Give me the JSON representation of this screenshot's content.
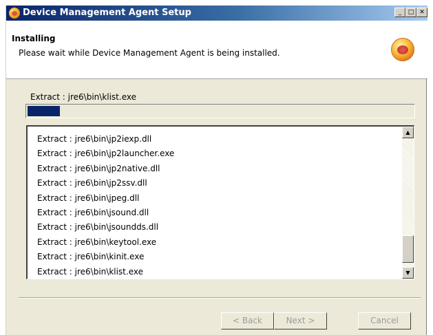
{
  "window": {
    "title": "Device Management Agent Setup",
    "minimize_glyph": "_",
    "maximize_glyph": "□",
    "close_glyph": "✕"
  },
  "header": {
    "title": "Installing",
    "subtitle": "Please wait while Device Management Agent is being installed.",
    "logo_icon": "installer-logo-icon"
  },
  "status": {
    "current_action": "Extract : jre6\\bin\\klist.exe",
    "progress_percent": 8.5
  },
  "log": {
    "items": [
      "Extract : jre6\\bin\\jp2iexp.dll",
      "Extract : jre6\\bin\\jp2launcher.exe",
      "Extract : jre6\\bin\\jp2native.dll",
      "Extract : jre6\\bin\\jp2ssv.dll",
      "Extract : jre6\\bin\\jpeg.dll",
      "Extract : jre6\\bin\\jsound.dll",
      "Extract : jre6\\bin\\jsoundds.dll",
      "Extract : jre6\\bin\\keytool.exe",
      "Extract : jre6\\bin\\kinit.exe",
      "Extract : jre6\\bin\\klist.exe"
    ],
    "scroll_up_glyph": "▲",
    "scroll_down_glyph": "▼"
  },
  "buttons": {
    "back": "< Back",
    "next": "Next >",
    "cancel": "Cancel"
  },
  "colors": {
    "progress_fill": "#0a246a",
    "disabled_text": "#9b9b9b"
  }
}
